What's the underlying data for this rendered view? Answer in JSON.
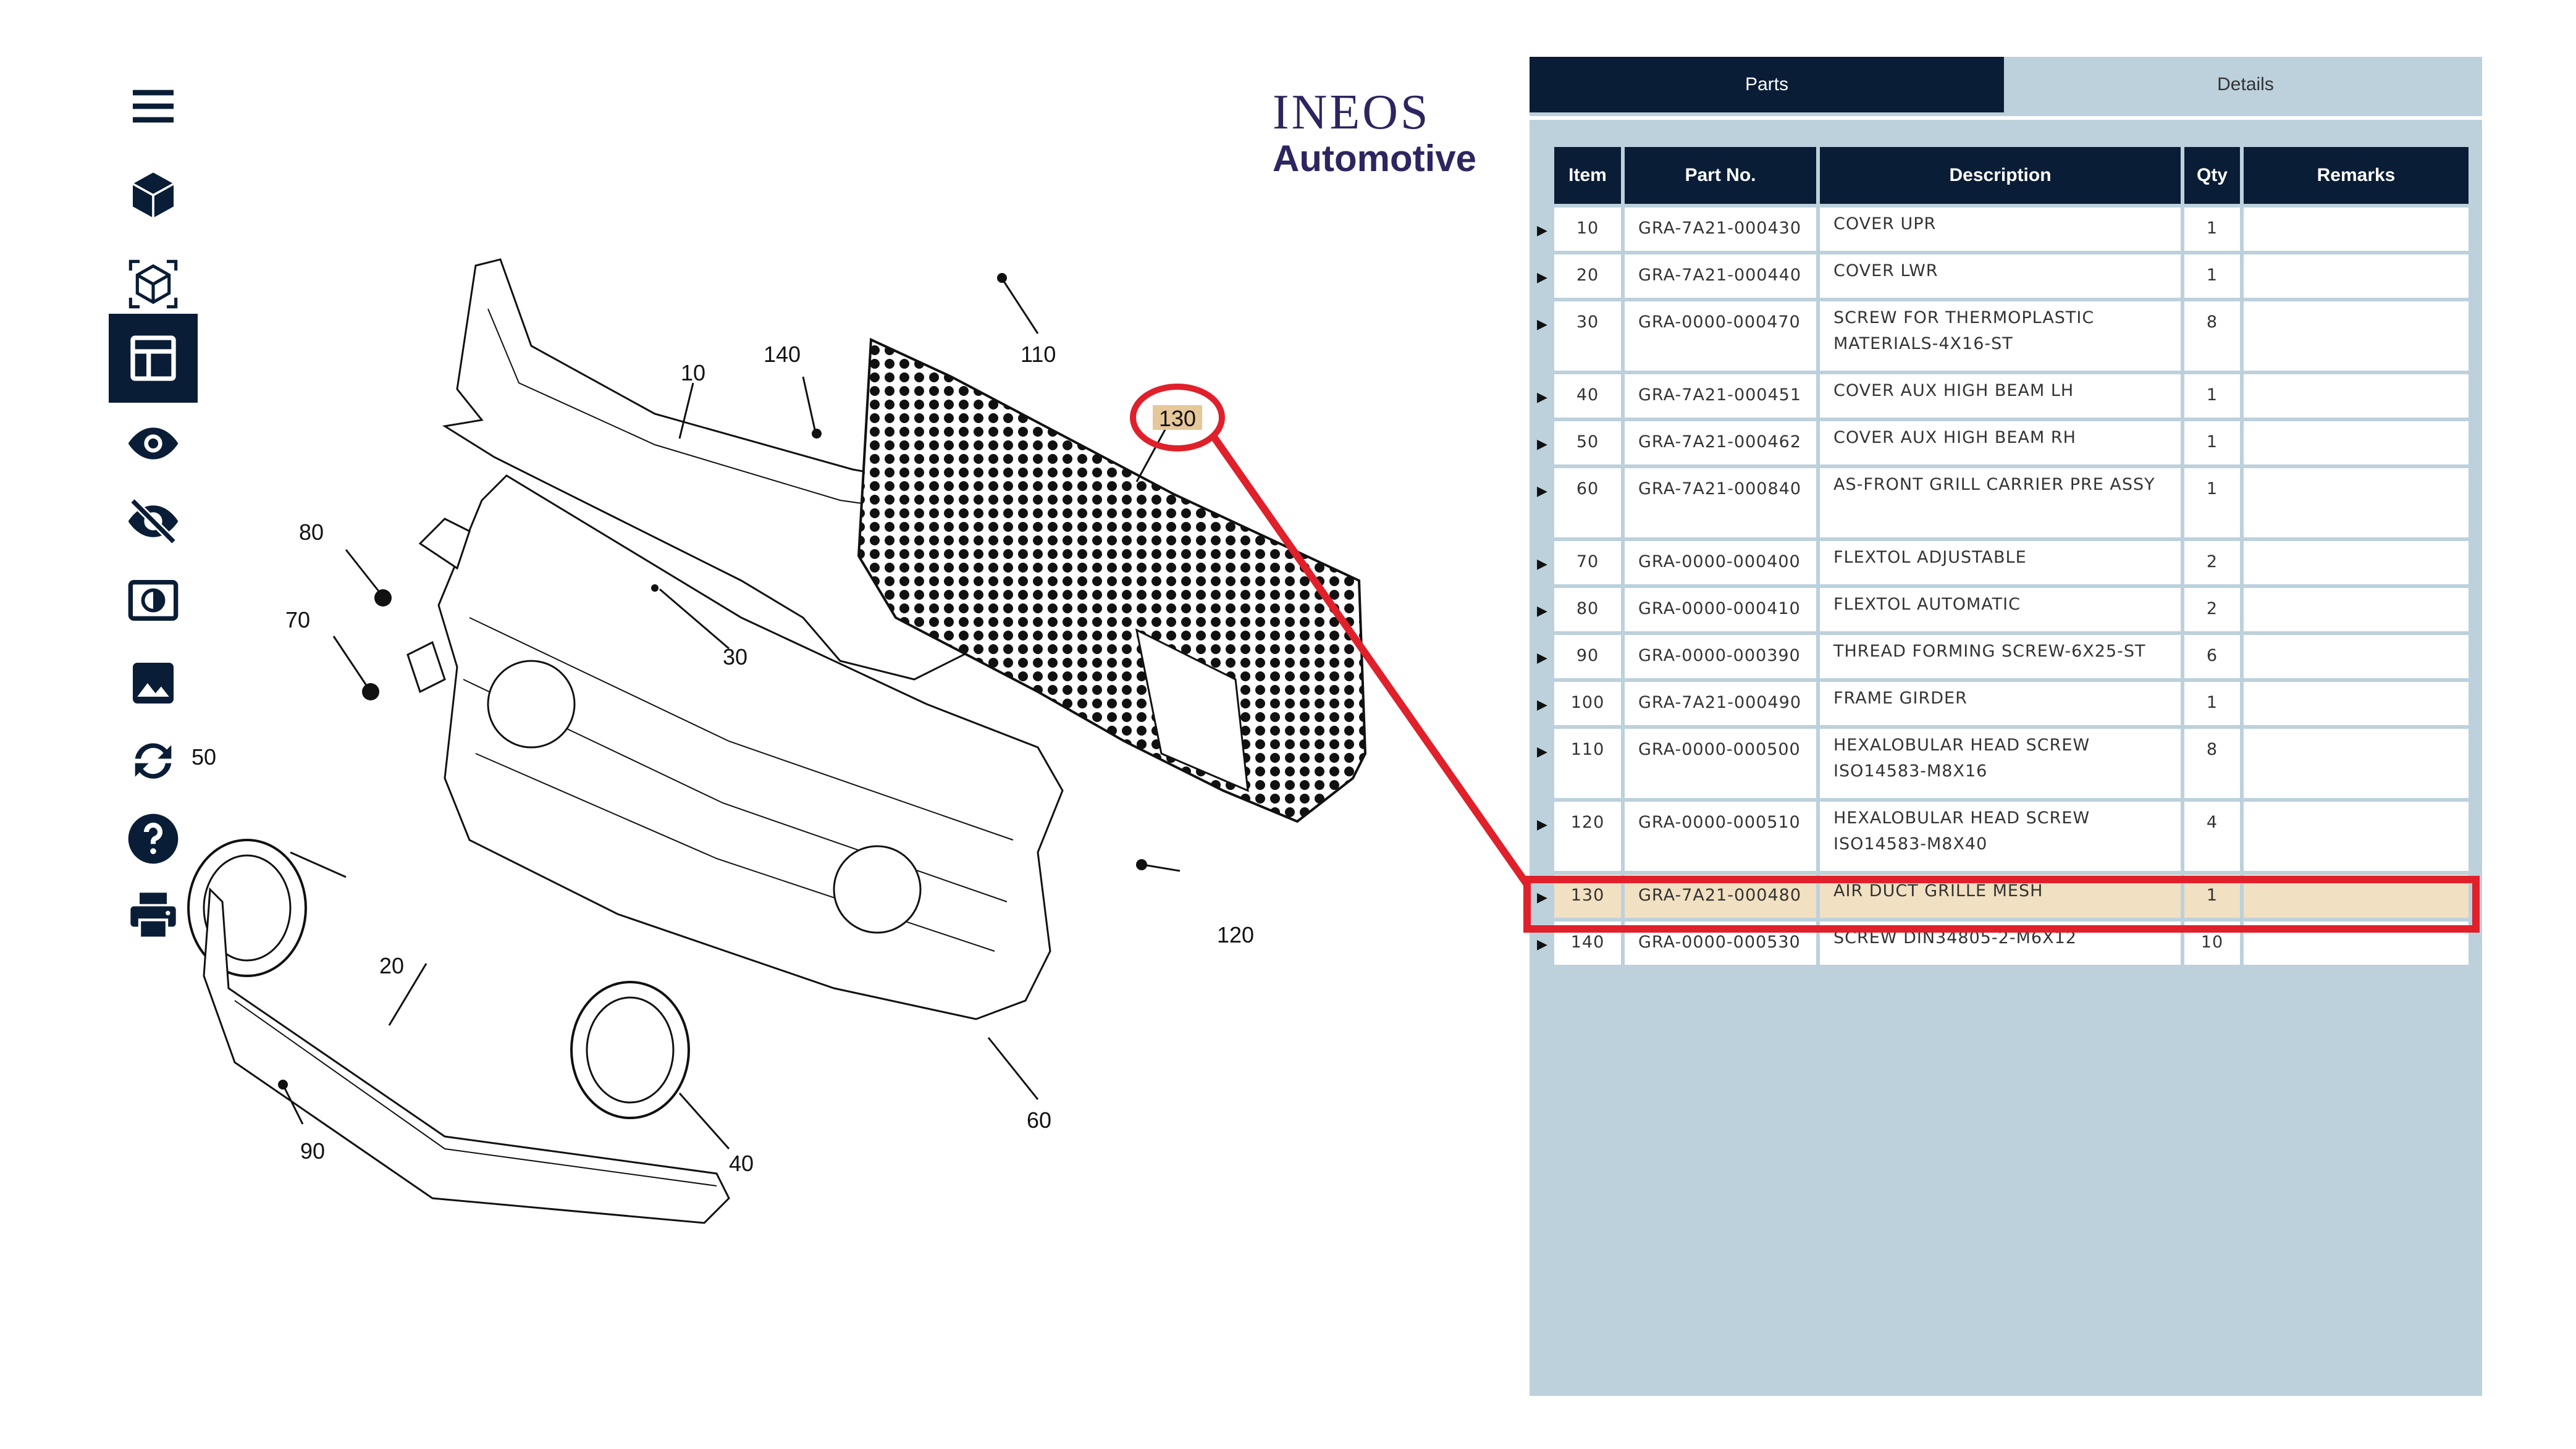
{
  "toolbar": {
    "items": [
      {
        "name": "menu-icon",
        "active": false
      },
      {
        "name": "cube-icon",
        "active": false
      },
      {
        "name": "wireframe-cube-icon",
        "active": false
      },
      {
        "name": "table-layout-icon",
        "active": true
      },
      {
        "name": "eye-icon",
        "active": false
      },
      {
        "name": "eye-off-icon",
        "active": false
      },
      {
        "name": "contrast-icon",
        "active": false
      },
      {
        "name": "image-icon",
        "active": false
      },
      {
        "name": "sync-icon",
        "active": false
      },
      {
        "name": "help-icon",
        "active": false
      },
      {
        "name": "print-icon",
        "active": false
      }
    ]
  },
  "logo": {
    "line1": "INEOS",
    "line2": "Automotive"
  },
  "diagram": {
    "callouts": [
      "10",
      "20",
      "30",
      "40",
      "50",
      "60",
      "70",
      "80",
      "90",
      "110",
      "120",
      "130",
      "140"
    ]
  },
  "tabs": {
    "parts": "Parts",
    "details": "Details"
  },
  "table": {
    "headers": {
      "item": "Item",
      "part": "Part No.",
      "desc": "Description",
      "qty": "Qty",
      "remarks": "Remarks"
    },
    "rows": [
      {
        "item": "10",
        "part": "GRA-7A21-000430",
        "desc": "COVER UPR",
        "qty": "1",
        "remarks": ""
      },
      {
        "item": "20",
        "part": "GRA-7A21-000440",
        "desc": "COVER LWR",
        "qty": "1",
        "remarks": ""
      },
      {
        "item": "30",
        "part": "GRA-0000-000470",
        "desc": "SCREW FOR THERMOPLASTIC MATERIALS-4X16-ST",
        "qty": "8",
        "remarks": ""
      },
      {
        "item": "40",
        "part": "GRA-7A21-000451",
        "desc": "COVER AUX HIGH BEAM LH",
        "qty": "1",
        "remarks": ""
      },
      {
        "item": "50",
        "part": "GRA-7A21-000462",
        "desc": "COVER AUX HIGH BEAM RH",
        "qty": "1",
        "remarks": ""
      },
      {
        "item": "60",
        "part": "GRA-7A21-000840",
        "desc": "AS-FRONT GRILL CARRIER PRE ASSY",
        "qty": "1",
        "remarks": ""
      },
      {
        "item": "70",
        "part": "GRA-0000-000400",
        "desc": "FLEXTOL ADJUSTABLE",
        "qty": "2",
        "remarks": ""
      },
      {
        "item": "80",
        "part": "GRA-0000-000410",
        "desc": "FLEXTOL AUTOMATIC",
        "qty": "2",
        "remarks": ""
      },
      {
        "item": "90",
        "part": "GRA-0000-000390",
        "desc": "THREAD FORMING SCREW-6X25-ST",
        "qty": "6",
        "remarks": ""
      },
      {
        "item": "100",
        "part": "GRA-7A21-000490",
        "desc": "FRAME GIRDER",
        "qty": "1",
        "remarks": ""
      },
      {
        "item": "110",
        "part": "GRA-0000-000500",
        "desc": "HEXALOBULAR HEAD SCREW ISO14583-M8X16",
        "qty": "8",
        "remarks": ""
      },
      {
        "item": "120",
        "part": "GRA-0000-000510",
        "desc": "HEXALOBULAR HEAD SCREW ISO14583-M8X40",
        "qty": "4",
        "remarks": ""
      },
      {
        "item": "130",
        "part": "GRA-7A21-000480",
        "desc": "AIR DUCT GRILLE MESH",
        "qty": "1",
        "remarks": "",
        "selected": true
      },
      {
        "item": "140",
        "part": "GRA-0000-000530",
        "desc": "SCREW DIN34805-2-M6X12",
        "qty": "10",
        "remarks": ""
      }
    ]
  },
  "colors": {
    "navy": "#0a1d36",
    "panel": "#bcd1dc",
    "selected_row": "#f1e0c1",
    "highlight_red": "#e0202a",
    "logo": "#2c2560"
  }
}
